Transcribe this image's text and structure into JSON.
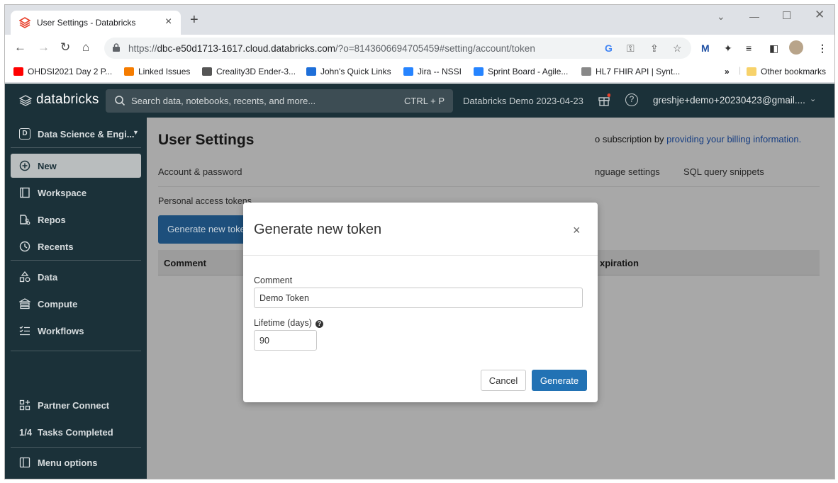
{
  "browser": {
    "tab_title": "User Settings - Databricks",
    "url_prefix": "https://",
    "url_host": "dbc-e50d1713-1617.cloud.databricks.com",
    "url_path": "/?o=8143606694705459#setting/account/token",
    "bookmarks": [
      {
        "label": "OHDSI2021 Day 2 P...",
        "color": "#ff0000"
      },
      {
        "label": "Linked Issues",
        "color": "#f57c00"
      },
      {
        "label": "Creality3D Ender-3...",
        "color": "#555555"
      },
      {
        "label": "John's Quick Links",
        "color": "#1e6fd9"
      },
      {
        "label": "Jira -- NSSI",
        "color": "#2684ff"
      },
      {
        "label": "Sprint Board - Agile...",
        "color": "#2684ff"
      },
      {
        "label": "HL7 FHIR API | Synt...",
        "color": "#888888"
      }
    ],
    "bookmarks_overflow": "»",
    "other_bookmarks": "Other bookmarks"
  },
  "app": {
    "logo": "databricks",
    "search_placeholder": "Search data, notebooks, recents, and more...",
    "search_shortcut": "CTRL + P",
    "workspace_name": "Databricks Demo 2023-04-23",
    "user_email": "greshje+demo+20230423@gmail....",
    "persona": "Data Science & Engi...",
    "persona_badge": "D"
  },
  "sidebar": {
    "items": [
      {
        "label": "New",
        "icon": "plus-circle-icon"
      },
      {
        "label": "Workspace",
        "icon": "workspace-icon"
      },
      {
        "label": "Repos",
        "icon": "repos-icon"
      },
      {
        "label": "Recents",
        "icon": "clock-icon"
      },
      {
        "label": "Data",
        "icon": "data-icon"
      },
      {
        "label": "Compute",
        "icon": "compute-icon"
      },
      {
        "label": "Workflows",
        "icon": "workflows-icon"
      }
    ],
    "partner_connect": "Partner Connect",
    "tasks_count": "1/4",
    "tasks_label": "Tasks Completed",
    "menu_options": "Menu options"
  },
  "page": {
    "title": "User Settings",
    "billing_prefix": "o subscription by ",
    "billing_link": "providing your billing information.",
    "tabs": [
      "Account & password",
      "nguage settings",
      "SQL query snippets"
    ],
    "pat_label": "Personal access tokens",
    "generate_button": "Generate new token",
    "table_headers": {
      "comment": "Comment",
      "expiration": "xpiration"
    }
  },
  "modal": {
    "title": "Generate new token",
    "close": "×",
    "comment_label": "Comment",
    "comment_value": "Demo Token",
    "lifetime_label": "Lifetime (days)",
    "lifetime_value": "90",
    "cancel": "Cancel",
    "generate": "Generate"
  },
  "colors": {
    "topbar": "#1b3139",
    "primary_button": "#2272b4",
    "overlay": "#a8a8a8"
  }
}
